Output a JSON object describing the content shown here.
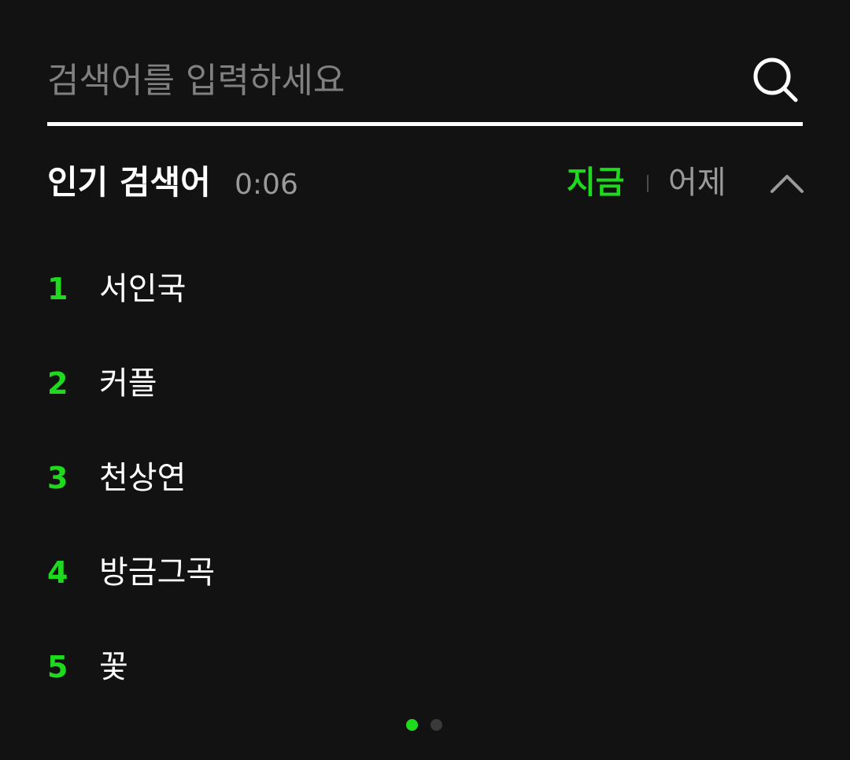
{
  "search": {
    "placeholder": "검색어를 입력하세요",
    "value": ""
  },
  "popular": {
    "title": "인기 검색어",
    "time": "0:06",
    "tabs": {
      "now": "지금",
      "yesterday": "어제"
    },
    "items": [
      {
        "rank": "1",
        "keyword": "서인국"
      },
      {
        "rank": "2",
        "keyword": "커플"
      },
      {
        "rank": "3",
        "keyword": "천상연"
      },
      {
        "rank": "4",
        "keyword": "방금그곡"
      },
      {
        "rank": "5",
        "keyword": "꽃"
      }
    ]
  },
  "pager": {
    "current_page": 1,
    "total_pages": 2
  },
  "colors": {
    "background": "#121212",
    "accent": "#1ed91e",
    "text": "#ffffff",
    "muted": "#9a9a9a"
  },
  "icons": {
    "search": "search-icon",
    "collapse": "chevron-up-icon"
  }
}
